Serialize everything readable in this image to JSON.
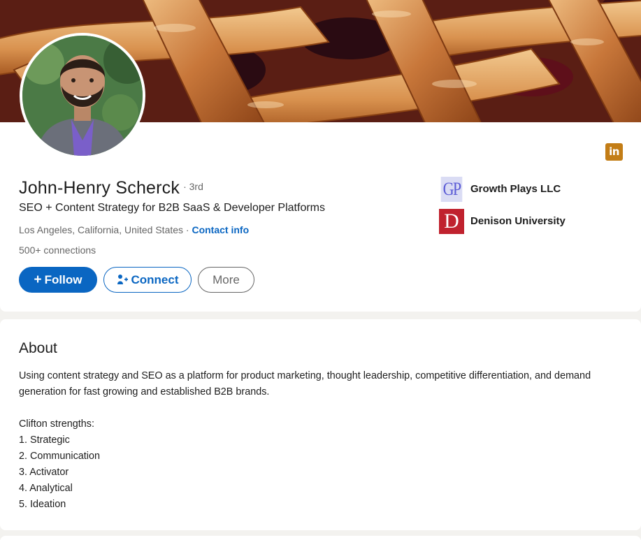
{
  "profile": {
    "name": "John-Henry Scherck",
    "degree": "· 3rd",
    "headline": "SEO + Content Strategy for B2B SaaS & Developer Platforms",
    "location": "Los Angeles, California, United States ·",
    "contact_label": "Contact info",
    "connections": "500+ connections",
    "linkedin_badge": "in",
    "banner_icon": "pie-crust-lattice-photo",
    "avatar_icon": "profile-photo"
  },
  "actions": {
    "follow_label": "Follow",
    "follow_prefix": "+",
    "connect_label": "Connect",
    "more_label": "More"
  },
  "organizations": [
    {
      "logo_text": "GP",
      "name": "Growth Plays LLC",
      "logo_color": "#5b5bd6",
      "logo_bg": "#dadcf4"
    },
    {
      "logo_text": "D",
      "name": "Denison University",
      "logo_color": "#ffffff",
      "logo_bg": "#c0222e"
    }
  ],
  "about": {
    "title": "About",
    "paragraph": "Using content strategy and SEO as a platform for product marketing, thought leadership, competitive differentiation, and demand generation for fast growing and established B2B brands.",
    "strengths_heading": "Clifton strengths:",
    "strengths": [
      "1. Strategic",
      "2. Communication",
      "3. Activator",
      "4. Analytical",
      "5. Ideation"
    ]
  },
  "colors": {
    "accent": "#0a66c2",
    "badge": "#c37d16",
    "page_bg": "#f3f2ef"
  }
}
